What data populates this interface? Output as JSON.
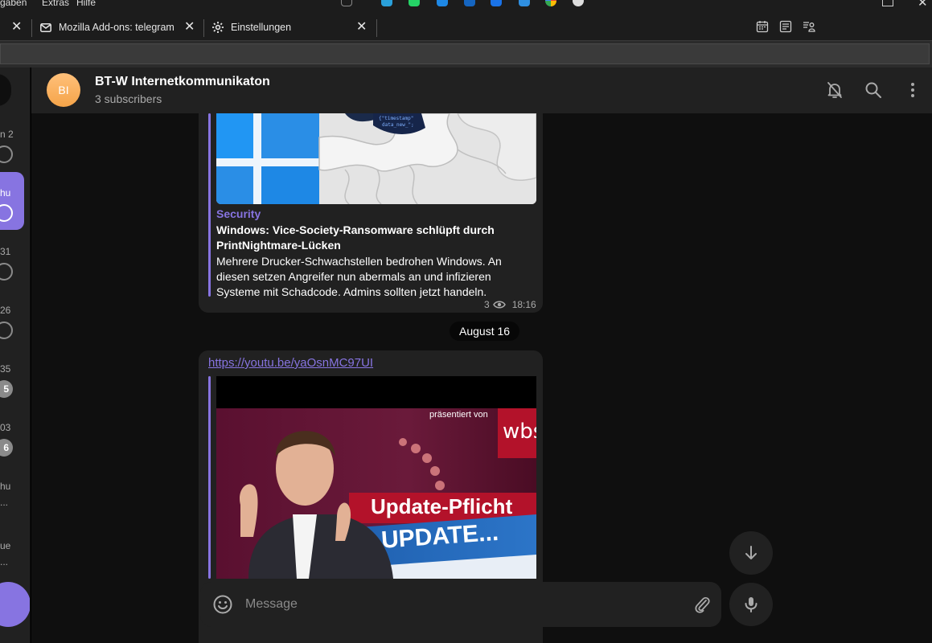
{
  "browser": {
    "menu": [
      "gaben",
      "Extras",
      "Hilfe"
    ],
    "extension_colors": [
      "#2aa0da",
      "#25d366",
      "#1e88e5",
      "#1565c0",
      "#1a73e8",
      "#2f8fe0"
    ],
    "tabs": [
      {
        "title": "Mozilla Add-ons: telegram",
        "icon": "mail-icon"
      },
      {
        "title": "Einstellungen",
        "icon": "gear-icon"
      }
    ]
  },
  "left_list": {
    "items": [
      {
        "time": "n 2",
        "indicator": "pin-icon"
      },
      {
        "time": "hu",
        "indicator": "pin-icon",
        "active": true
      },
      {
        "time": "31",
        "indicator": "pin-icon"
      },
      {
        "time": "26",
        "indicator": "pin-icon"
      },
      {
        "time": "35",
        "badge": "5"
      },
      {
        "time": "03",
        "badge": "6"
      },
      {
        "time": "hu",
        "preview": "..."
      },
      {
        "time": "ue",
        "preview": "..."
      }
    ]
  },
  "channel": {
    "avatar_initials": "BI",
    "title": "BT-W Internetkommunikaton",
    "subtitle": "3 subscribers"
  },
  "messages": [
    {
      "category": "Security",
      "title": "Windows: Vice-Society-Ransomware schlüpft durch PrintNightmare-Lücken",
      "description": "Mehrere Drucker-Schwachstellen bedrohen Windows. An diesen setzen Angreifer nun abermals an und infizieren Systeme mit Schadcode. Admins sollten jetzt handeln.",
      "views": "3",
      "time": "18:16"
    }
  ],
  "date_separator": "August 16",
  "message2": {
    "link": "https://youtu.be/yaOsnMC97UI",
    "video_texts": {
      "presented": "präsentiert von",
      "brand": "wbs",
      "headline": "Update-Pflicht",
      "update": "UPDATE..."
    }
  },
  "composer": {
    "placeholder": "Message"
  },
  "colors": {
    "accent": "#8774e1",
    "bubble": "#212121",
    "background": "#0f0f0f"
  }
}
